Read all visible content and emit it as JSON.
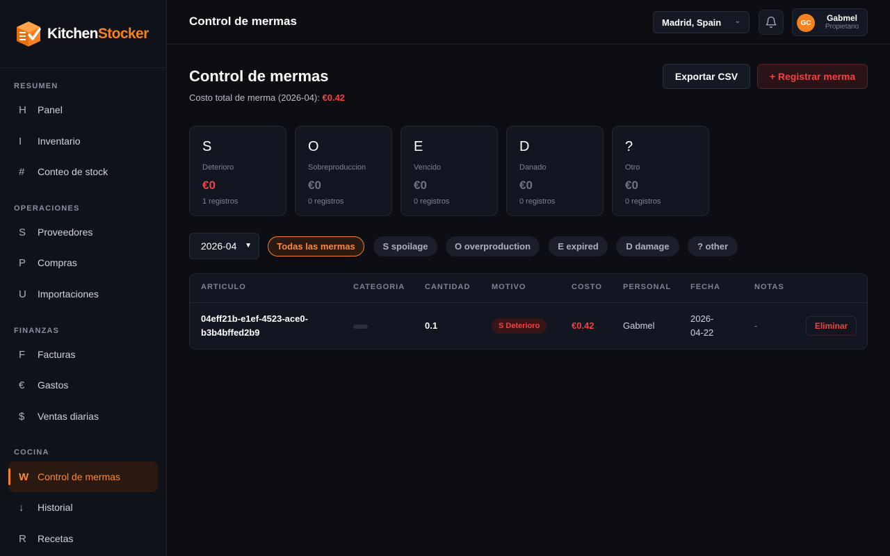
{
  "brand": {
    "name_part1": "Kitchen",
    "name_part2": "Stocker",
    "logo_icon": "box-check-icon",
    "accent": "#f5821f"
  },
  "sidebar": {
    "sections": [
      {
        "label": "RESUMEN",
        "items": [
          {
            "glyph": "H",
            "label": "Panel"
          },
          {
            "glyph": "I",
            "label": "Inventario"
          },
          {
            "glyph": "#",
            "label": "Conteo de stock"
          }
        ]
      },
      {
        "label": "OPERACIONES",
        "items": [
          {
            "glyph": "S",
            "label": "Proveedores"
          },
          {
            "glyph": "P",
            "label": "Compras"
          },
          {
            "glyph": "U",
            "label": "Importaciones"
          }
        ]
      },
      {
        "label": "FINANZAS",
        "items": [
          {
            "glyph": "F",
            "label": "Facturas"
          },
          {
            "glyph": "€",
            "label": "Gastos"
          },
          {
            "glyph": "$",
            "label": "Ventas diarias"
          }
        ]
      },
      {
        "label": "COCINA",
        "items": [
          {
            "glyph": "W",
            "label": "Control de mermas",
            "active": true
          },
          {
            "glyph": "↓",
            "label": "Historial"
          },
          {
            "glyph": "R",
            "label": "Recetas"
          }
        ]
      }
    ]
  },
  "topbar": {
    "title": "Control de mermas",
    "location": "Madrid, Spain",
    "bell_icon": "bell-icon",
    "user": {
      "initials": "GC",
      "name": "Gabmel",
      "role": "Propietario"
    }
  },
  "page": {
    "title": "Control de mermas",
    "subtitle_prefix": "Costo total de merma (2026-04):",
    "subtitle_value": "€0.42",
    "export_label": "Exportar CSV",
    "register_label": "+ Registrar merma"
  },
  "stats": [
    {
      "letter": "S",
      "label": "Deterioro",
      "value": "€0",
      "count": "1 registros",
      "highlight": true
    },
    {
      "letter": "O",
      "label": "Sobreproduccion",
      "value": "€0",
      "count": "0 registros"
    },
    {
      "letter": "E",
      "label": "Vencido",
      "value": "€0",
      "count": "0 registros"
    },
    {
      "letter": "D",
      "label": "Danado",
      "value": "€0",
      "count": "0 registros"
    },
    {
      "letter": "?",
      "label": "Otro",
      "value": "€0",
      "count": "0 registros"
    }
  ],
  "filters": {
    "month": "2026-04",
    "chips": [
      {
        "label": "Todas las mermas",
        "active": true
      },
      {
        "label": "S spoilage"
      },
      {
        "label": "O overproduction"
      },
      {
        "label": "E expired"
      },
      {
        "label": "D damage"
      },
      {
        "label": "? other"
      }
    ]
  },
  "table": {
    "headers": [
      "ARTICULO",
      "CATEGORIA",
      "CANTIDAD",
      "MOTIVO",
      "COSTO",
      "PERSONAL",
      "FECHA",
      "NOTAS"
    ],
    "rows": [
      {
        "article_line1": "04eff21b-e1ef-4523-ace0-",
        "article_line2": "b3b4bffed2b9",
        "quantity": "0.1",
        "reason": "S Deterioro",
        "cost": "€0.42",
        "staff": "Gabmel",
        "date_line1": "2026-",
        "date_line2": "04-22",
        "notes": "-",
        "delete_label": "Eliminar"
      }
    ]
  }
}
